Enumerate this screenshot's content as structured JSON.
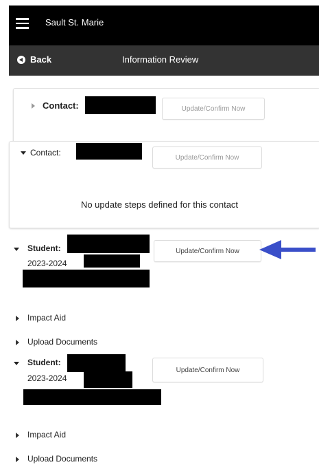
{
  "header": {
    "app_title": "Sault St. Marie",
    "back_label": "Back",
    "page_title": "Information Review"
  },
  "contacts": [
    {
      "label": "Contact:",
      "expanded": false,
      "button_label": "Update/Confirm Now"
    },
    {
      "label": "Contact:",
      "expanded": true,
      "button_label": "Update/Confirm Now",
      "message": "No update steps defined for this contact"
    }
  ],
  "students": [
    {
      "label": "Student:",
      "year": "2023-2024",
      "button_label": "Update/Confirm Now",
      "sub_items": [
        "Impact Aid",
        "Upload Documents"
      ]
    },
    {
      "label": "Student:",
      "year": "2023-2024",
      "button_label": "Update/Confirm Now",
      "sub_items": [
        "Impact Aid",
        "Upload Documents"
      ]
    }
  ],
  "annotation": {
    "arrow_color": "#3a4fc9"
  },
  "colors": {
    "topbar": "#000000",
    "navbar": "#333333"
  }
}
